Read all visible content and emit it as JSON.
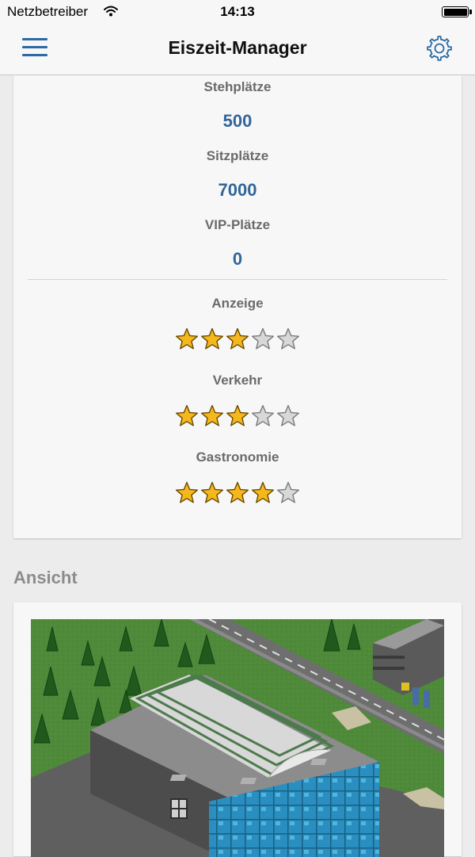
{
  "status_bar": {
    "carrier": "Netzbetreiber",
    "time": "14:13"
  },
  "nav": {
    "title": "Eiszeit-Manager",
    "menu_icon": "hamburger-menu-icon",
    "settings_icon": "gear-icon"
  },
  "capacity": [
    {
      "label": "Stehplätze",
      "value": "500"
    },
    {
      "label": "Sitzplätze",
      "value": "7000"
    },
    {
      "label": "VIP-Plätze",
      "value": "0"
    }
  ],
  "ratings": [
    {
      "label": "Anzeige",
      "stars": 3,
      "max": 5
    },
    {
      "label": "Verkehr",
      "stars": 3,
      "max": 5
    },
    {
      "label": "Gastronomie",
      "stars": 4,
      "max": 5
    }
  ],
  "view_section": {
    "title": "Ansicht"
  },
  "colors": {
    "accent": "#2c6aa3",
    "value_text": "#31659b",
    "label_text": "#6a6a6a",
    "star_filled": "#f5b81c",
    "star_empty": "#d8d8d8",
    "grass": "#4f8a3a",
    "road": "#6e6e6e"
  }
}
